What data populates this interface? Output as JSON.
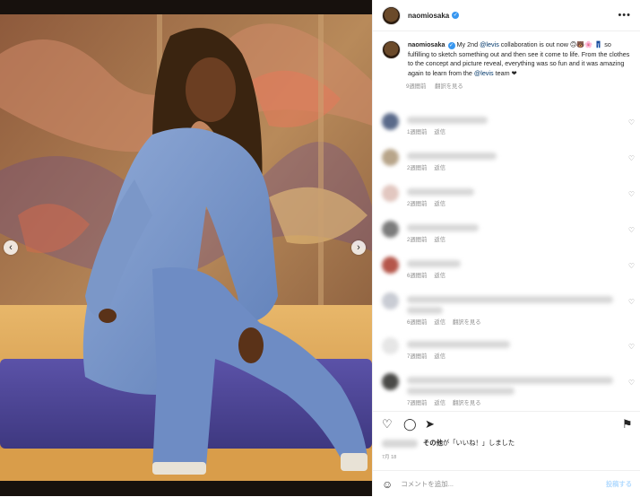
{
  "post": {
    "username": "naomiosaka",
    "verified_mark": "✓",
    "more_label": "•••",
    "nav_prev": "‹",
    "nav_next": "›"
  },
  "caption": {
    "username": "naomiosaka",
    "text_1": " My 2nd ",
    "mention_1": "@levis",
    "text_2": " collaboration is out now 🙃🐻🌸 👖 so fulfilling to sketch something out and then see it come to life. From the clothes to the concept and picture reveal, everything was so fun and it was amazing again to learn from the ",
    "mention_2": "@levis",
    "text_3": " team ❤",
    "time": "9週間前",
    "translate": "翻訳を見る"
  },
  "comments": [
    {
      "time": "1週間前",
      "reply": "返信",
      "translate": "",
      "avatar_color": "#5a6a8a"
    },
    {
      "time": "2週間前",
      "reply": "返信",
      "translate": "",
      "avatar_color": "#b8a58a"
    },
    {
      "time": "2週間前",
      "reply": "返信",
      "translate": "",
      "avatar_color": "#e2c7c0"
    },
    {
      "time": "2週間前",
      "reply": "返信",
      "translate": "",
      "avatar_color": "#7c7c7c"
    },
    {
      "time": "6週間前",
      "reply": "返信",
      "translate": "",
      "avatar_color": "#b5564a"
    },
    {
      "time": "6週間前",
      "reply": "返信",
      "translate": "翻訳を見る",
      "avatar_color": "#c9ccd4"
    },
    {
      "time": "7週間前",
      "reply": "返信",
      "translate": "",
      "avatar_color": "#e6e6e6"
    },
    {
      "time": "7週間前",
      "reply": "返信",
      "translate": "翻訳を見る",
      "avatar_color": "#4a4a48"
    }
  ],
  "actions": {
    "heart_icon": "♡",
    "comment_icon": "◯",
    "share_icon": "➤",
    "save_icon": "⚑",
    "likes_text": "その他が「いいね！」しました",
    "likes_bold": "その他",
    "likes_rest": "が「いいね！」しました",
    "date": "7月 18"
  },
  "add_comment": {
    "emoji_icon": "☺",
    "placeholder": "コメントを追加...",
    "post_label": "投稿する"
  },
  "colors": {
    "link": "#00376b",
    "verified": "#3897f0",
    "meta": "#8e8e8e"
  }
}
